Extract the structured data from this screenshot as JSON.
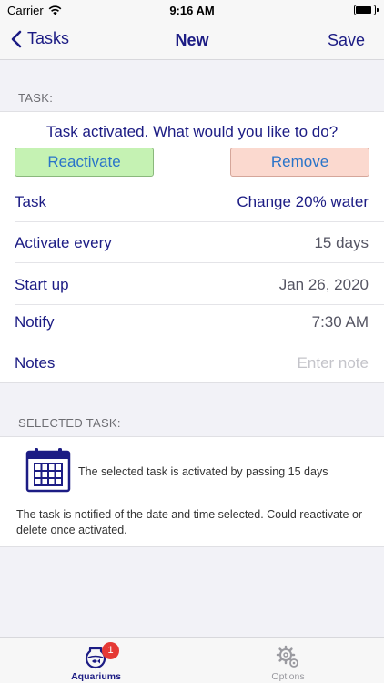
{
  "status": {
    "carrier": "Carrier",
    "time": "9:16 AM"
  },
  "nav": {
    "back_label": "Tasks",
    "title": "New",
    "save_label": "Save"
  },
  "task_section": {
    "header": "TASK:",
    "prompt": "Task activated. What would you like to do?",
    "reactivate_label": "Reactivate",
    "remove_label": "Remove",
    "rows": [
      {
        "label": "Task",
        "value": "Change 20% water"
      },
      {
        "label": "Activate every",
        "value": "15 days"
      },
      {
        "label": "Start up",
        "value": "Jan 26, 2020"
      },
      {
        "label": "Notify",
        "value": "7:30 AM"
      },
      {
        "label": "Notes",
        "placeholder": "Enter note"
      }
    ]
  },
  "selected_section": {
    "header": "SELECTED TASK:",
    "summary": "The selected task is activated by passing 15 days",
    "note": "The task is notified of the date and time selected. Could reactivate or delete once activated."
  },
  "tabs": {
    "aquariums_label": "Aquariums",
    "aquariums_badge": "1",
    "options_label": "Options"
  },
  "colors": {
    "accent": "#1c1c84",
    "reactivate_bg": "#c5f2b3",
    "remove_bg": "#fbd9cf",
    "badge": "#e53935"
  }
}
